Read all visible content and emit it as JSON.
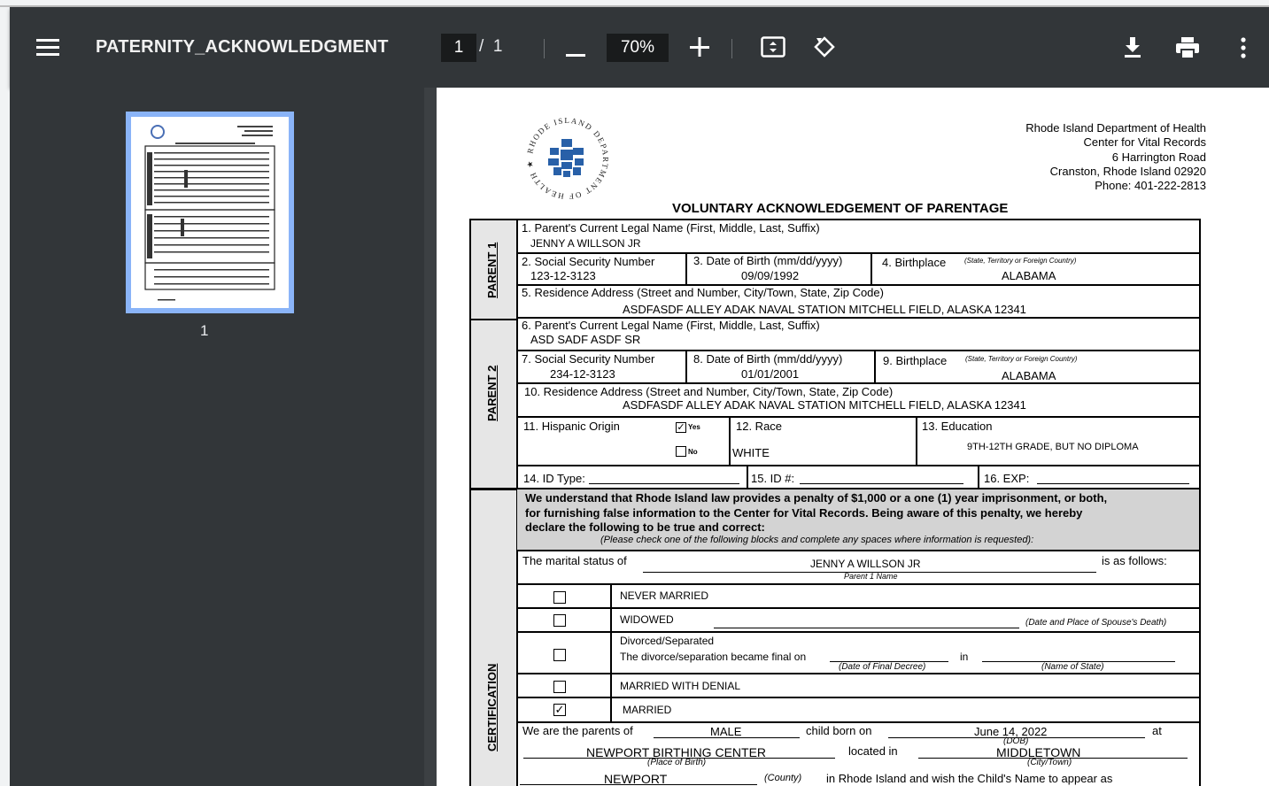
{
  "toolbar": {
    "title": "PATERNITY_ACKNOWLEDGMENT",
    "current_page": "1",
    "page_separator": "/",
    "total_pages": "1",
    "zoom": "70%",
    "icons": [
      "menu-icon",
      "zoom-out-icon",
      "zoom-in-icon",
      "fit-page-icon",
      "rotate-icon",
      "download-icon",
      "print-icon",
      "more-vert-icon"
    ]
  },
  "sidebar": {
    "thumbnail_label": "1"
  },
  "colors": {
    "toolbar_bg": "#323639",
    "viewer_bg": "#525659",
    "thumb_highlight": "#8ab4f8",
    "sidebar_bg": "#323639"
  },
  "doc": {
    "seal_text": "RHODE ISLAND DEPARTMENT OF HEALTH",
    "dept": [
      "Rhode Island Department of Health",
      "Center for Vital Records",
      "6 Harrington Road",
      "Cranston, Rhode Island 02920",
      "Phone: 401-222-2813"
    ],
    "form_title": "VOLUNTARY ACKNOWLEDGEMENT OF PARENTAGE",
    "side_parent1": "PARENT 1",
    "side_parent2": "PARENT 2",
    "side_cert": "CERTIFICATION",
    "p1_name_label": "1. Parent's Current Legal Name (First, Middle, Last, Suffix)",
    "p1_name": "JENNY A WILLSON JR",
    "p1_ssn_label": "2. Social Security Number",
    "p1_ssn": "123-12-3123",
    "p1_dob_label": "3. Date of Birth (mm/dd/yyyy)",
    "p1_dob": "09/09/1992",
    "p1_bp_label": "4. Birthplace",
    "bp_hint": "(State, Territory or Foreign Country)",
    "p1_bp": "ALABAMA",
    "p1_addr_label": "5. Residence Address (Street and Number, City/Town, State, Zip Code)",
    "p1_addr": "ASDFASDF ALLEY ADAK NAVAL STATION MITCHELL FIELD, ALASKA 12341",
    "p2_name_label": "6. Parent's Current Legal Name (First, Middle, Last, Suffix)",
    "p2_name": "ASD SADF ASDF SR",
    "p2_ssn_label": "7. Social Security Number",
    "p2_ssn": "234-12-3123",
    "p2_dob_label": "8. Date of Birth (mm/dd/yyyy)",
    "p2_dob": "01/01/2001",
    "p2_bp_label": "9. Birthplace",
    "p2_bp": "ALABAMA",
    "p2_addr_label": "10. Residence Address (Street and Number, City/Town, State, Zip Code)",
    "p2_addr": "ASDFASDF ALLEY ADAK NAVAL STATION MITCHELL FIELD, ALASKA 12341",
    "hisp_label": "11. Hispanic Origin",
    "yes": "Yes",
    "no": "No",
    "race_label": "12. Race",
    "race": "WHITE",
    "edu_label": "13. Education",
    "edu": "9TH-12TH GRADE, BUT NO DIPLOMA",
    "id_type": "14. ID Type:",
    "id_no": "15. ID #:",
    "exp": "16. EXP:",
    "warning": [
      "We understand that Rhode Island law provides a penalty of $1,000 or a one (1) year imprisonment, or both,",
      "for furnishing false information to the Center for Vital Records. Being aware of this penalty, we hereby",
      "declare the following to be true and correct:"
    ],
    "warning_note": "(Please check one of the following blocks and complete any spaces where information is requested):",
    "marital_prefix": "The marital status of",
    "marital_name": "JENNY A WILLSON JR",
    "marital_suffix": "is as follows:",
    "parent1_name_caption": "Parent 1 Name",
    "never_married": "NEVER MARRIED",
    "widowed": "WIDOWED",
    "widowed_hint": "(Date and Place of Spouse's Death)",
    "divorced": "Divorced/Separated",
    "divorced_line": "The divorce/separation became final on",
    "in_word": "in",
    "final_decree": "(Date of Final Decree)",
    "state_caption": "(Name of State)",
    "married_denial": "MARRIED WITH DENIAL",
    "married": "MARRIED",
    "parents_of": "We are the parents of",
    "child_sex": "MALE",
    "child_born_on": "child born on",
    "dob_value": "June 14, 2022",
    "at_word": "at",
    "dob_caption": "(DOB)",
    "birth_place": "NEWPORT BIRTHING CENTER",
    "located_in": "located in",
    "city": "MIDDLETOWN",
    "place_caption": "(Place of Birth)",
    "city_caption": "(City/Town)",
    "county": "NEWPORT",
    "county_caption": "(County)",
    "last_line": "in Rhode Island and wish the Child's Name to appear as"
  }
}
